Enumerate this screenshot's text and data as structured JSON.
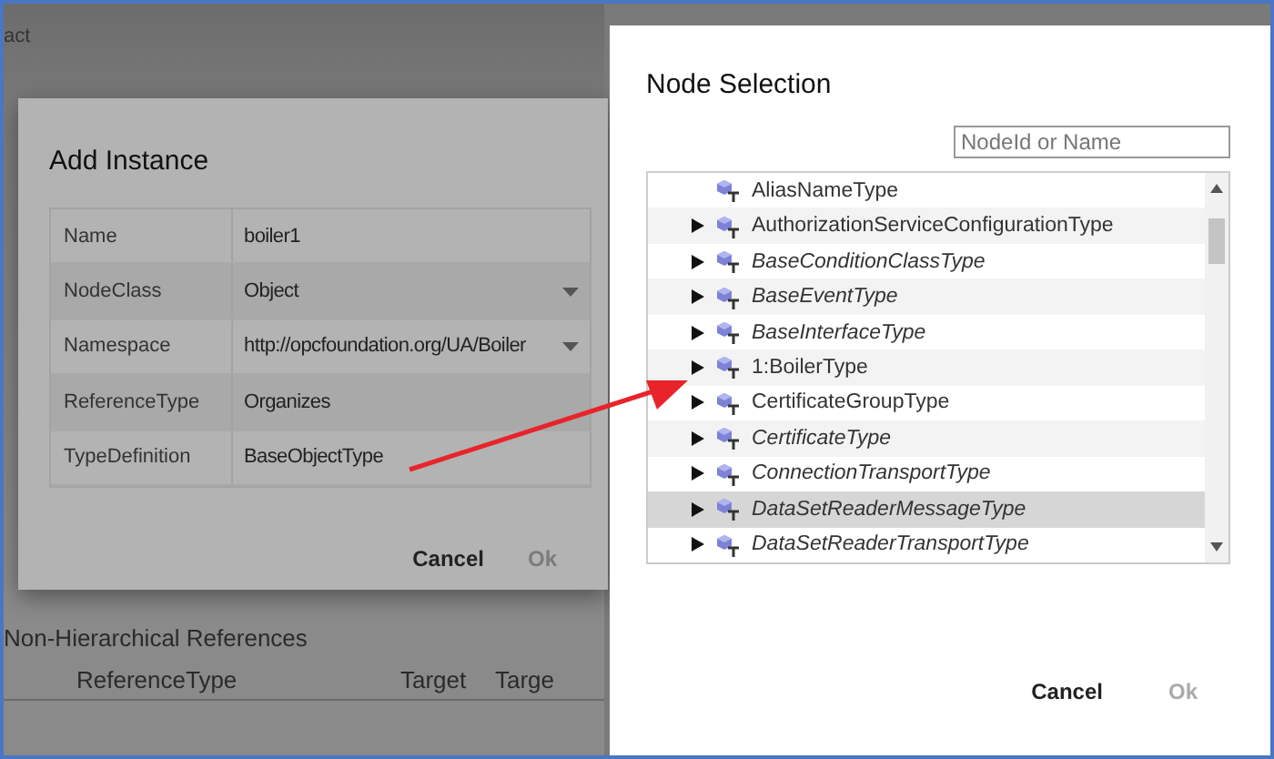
{
  "background": {
    "subtitle": "act",
    "section_title": "Non-Hierarchical References",
    "columns": [
      "ReferenceType",
      "Target",
      "Targe"
    ]
  },
  "add_instance": {
    "title": "Add Instance",
    "fields": [
      {
        "label": "Name",
        "value": "boiler1",
        "dropdown": false
      },
      {
        "label": "NodeClass",
        "value": "Object",
        "dropdown": true
      },
      {
        "label": "Namespace",
        "value": "http://opcfoundation.org/UA/Boiler",
        "dropdown": true
      },
      {
        "label": "ReferenceType",
        "value": "Organizes",
        "dropdown": false
      },
      {
        "label": "TypeDefinition",
        "value": "BaseObjectType",
        "dropdown": false
      }
    ],
    "buttons": [
      {
        "label": "Cancel",
        "disabled": false
      },
      {
        "label": "Ok",
        "disabled": true
      }
    ]
  },
  "node_selection": {
    "title": "Node Selection",
    "search": {
      "placeholder": "NodeId or Name"
    },
    "items": [
      {
        "label": "AliasNameType",
        "expandable": false,
        "italic": false,
        "selected": false
      },
      {
        "label": "AuthorizationServiceConfigurationType",
        "expandable": true,
        "italic": false,
        "selected": false
      },
      {
        "label": "BaseConditionClassType",
        "expandable": true,
        "italic": true,
        "selected": false
      },
      {
        "label": "BaseEventType",
        "expandable": true,
        "italic": true,
        "selected": false
      },
      {
        "label": "BaseInterfaceType",
        "expandable": true,
        "italic": true,
        "selected": false
      },
      {
        "label": "1:BoilerType",
        "expandable": true,
        "italic": false,
        "selected": false
      },
      {
        "label": "CertificateGroupType",
        "expandable": true,
        "italic": false,
        "selected": false
      },
      {
        "label": "CertificateType",
        "expandable": true,
        "italic": true,
        "selected": false
      },
      {
        "label": "ConnectionTransportType",
        "expandable": true,
        "italic": true,
        "selected": false
      },
      {
        "label": "DataSetReaderMessageType",
        "expandable": true,
        "italic": true,
        "selected": true
      },
      {
        "label": "DataSetReaderTransportType",
        "expandable": true,
        "italic": true,
        "selected": false
      }
    ],
    "buttons": [
      {
        "label": "Cancel",
        "disabled": false
      },
      {
        "label": "Ok",
        "disabled": true
      }
    ]
  }
}
